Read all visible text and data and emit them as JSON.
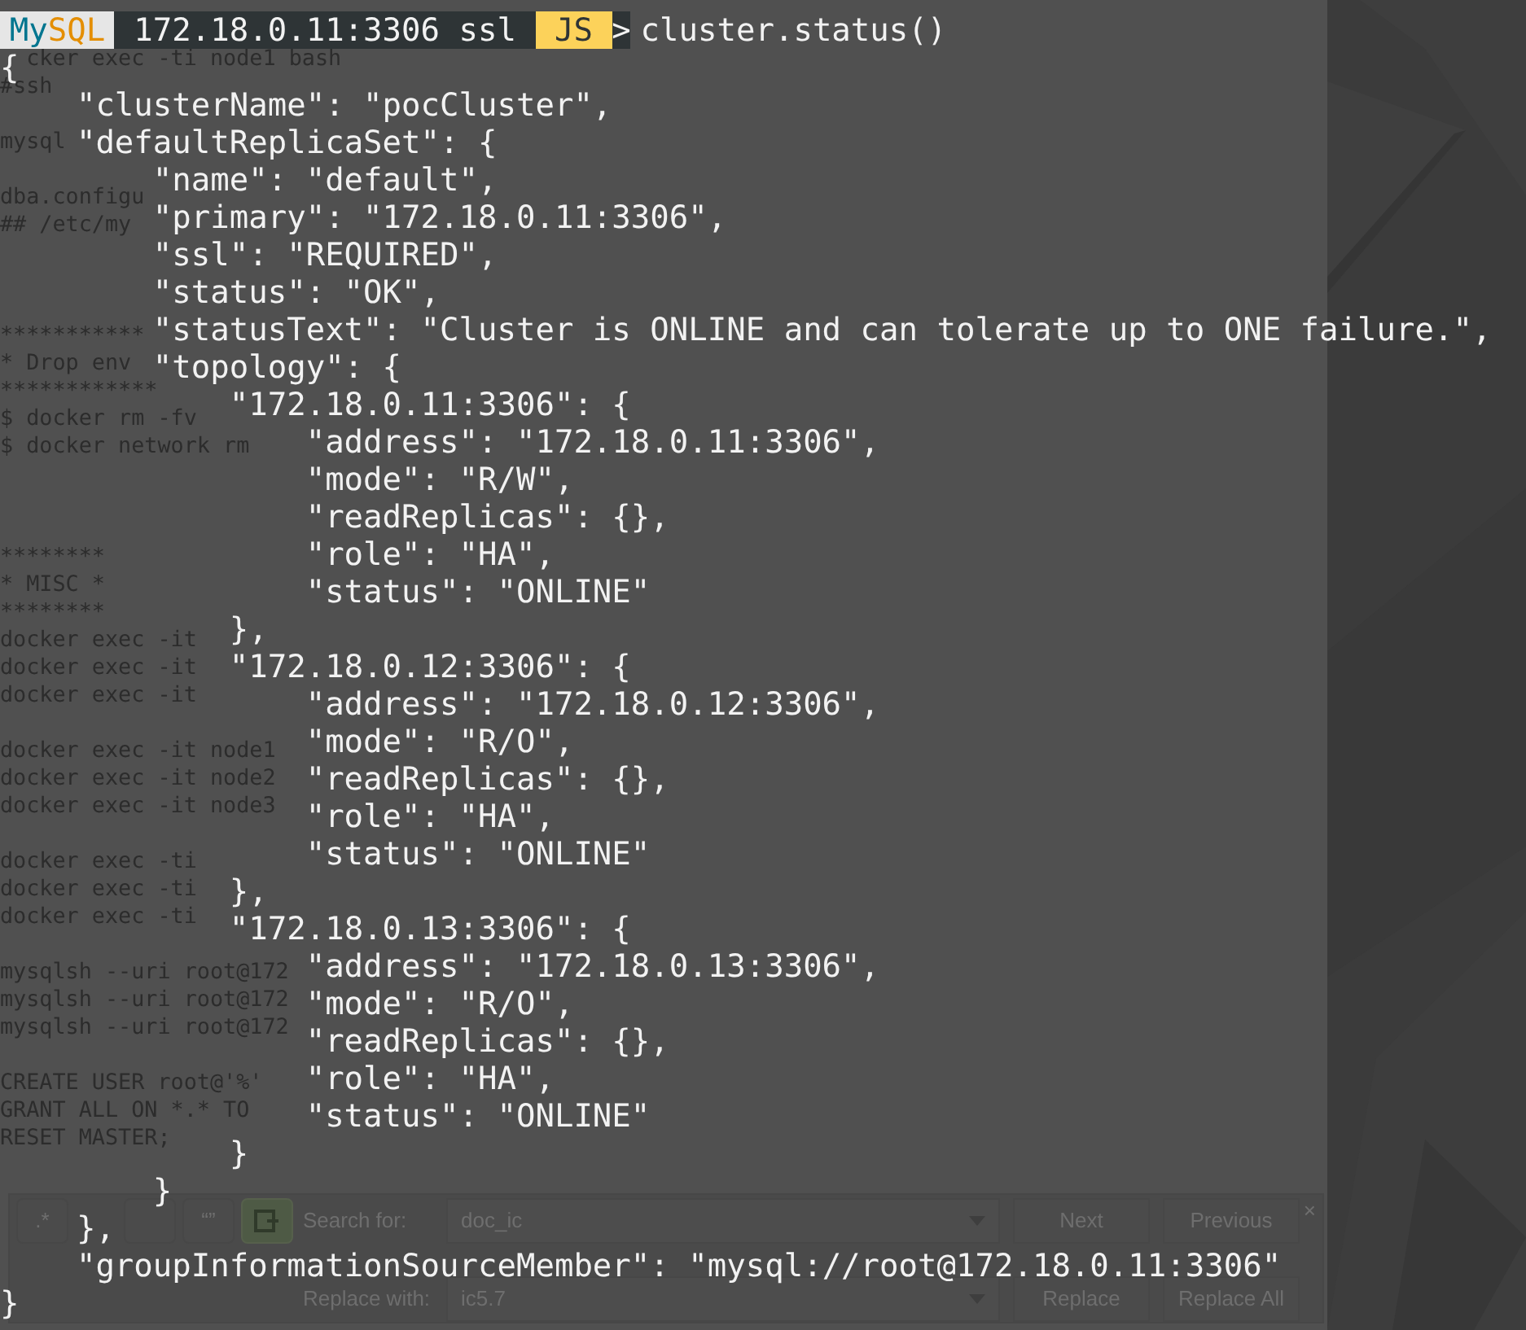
{
  "editor": {
    "lines": [
      {
        "kind": "offset",
        "text": "cker exec -ti node1 bash"
      },
      {
        "kind": "text",
        "text": "#ssh"
      },
      {
        "kind": "blank"
      },
      {
        "kind": "text",
        "text": "mysql"
      },
      {
        "kind": "blank"
      },
      {
        "kind": "text",
        "text": "dba.configu"
      },
      {
        "kind": "text",
        "text": "## /etc/my"
      },
      {
        "kind": "blank"
      },
      {
        "kind": "blank"
      },
      {
        "kind": "blank"
      },
      {
        "kind": "text",
        "text": "***********"
      },
      {
        "kind": "text",
        "text": "* Drop env"
      },
      {
        "kind": "text",
        "text": "************"
      },
      {
        "kind": "text",
        "text": "$ docker rm -fv"
      },
      {
        "kind": "text",
        "text": "$ docker network rm"
      },
      {
        "kind": "blank"
      },
      {
        "kind": "blank"
      },
      {
        "kind": "blank"
      },
      {
        "kind": "text",
        "text": "********"
      },
      {
        "kind": "text",
        "text": "* MISC *"
      },
      {
        "kind": "text",
        "text": "********"
      },
      {
        "kind": "text",
        "text": "docker exec -it"
      },
      {
        "kind": "text",
        "text": "docker exec -it"
      },
      {
        "kind": "text",
        "text": "docker exec -it"
      },
      {
        "kind": "blank"
      },
      {
        "kind": "text",
        "text": "docker exec -it node1"
      },
      {
        "kind": "text",
        "text": "docker exec -it node2"
      },
      {
        "kind": "text",
        "text": "docker exec -it node3"
      },
      {
        "kind": "blank"
      },
      {
        "kind": "text",
        "text": "docker exec -ti"
      },
      {
        "kind": "text",
        "text": "docker exec -ti"
      },
      {
        "kind": "text",
        "text": "docker exec -ti"
      },
      {
        "kind": "blank"
      },
      {
        "kind": "text",
        "text": "mysqlsh --uri root@172"
      },
      {
        "kind": "text",
        "text": "mysqlsh --uri root@172"
      },
      {
        "kind": "text",
        "text": "mysqlsh --uri root@172"
      },
      {
        "kind": "blank"
      },
      {
        "kind": "text",
        "text": "CREATE USER root@'%'"
      },
      {
        "kind": "text",
        "text": "GRANT ALL ON *.* TO"
      },
      {
        "kind": "text",
        "text": "RESET MASTER;"
      }
    ],
    "find_bar": {
      "toggles": [
        {
          "kind": "text",
          "label": ".*",
          "checked": false
        },
        {
          "kind": "covered",
          "checked": false
        },
        {
          "kind": "text",
          "label": "“”",
          "checked": false
        },
        {
          "kind": "icon",
          "checked": true
        }
      ],
      "search_label": "Search for:",
      "search_value": "doc_ic",
      "replace_label": "Replace with:",
      "replace_value": "ic5.7",
      "buttons": [
        "Next",
        "Previous"
      ],
      "replace_buttons": [
        "Replace",
        "Replace All"
      ],
      "close": "×"
    }
  },
  "terminal": {
    "prompt": {
      "product": [
        {
          "text": "My",
          "color": "#00758f"
        },
        {
          "text": "SQL",
          "color": "#e48e00"
        }
      ],
      "connection": "172.18.0.11:3306 ssl",
      "mode": "JS",
      "symbol": ">",
      "command": "cluster.status()"
    },
    "output": [
      {
        "text": "{",
        "children": [
          {
            "text": "\"clusterName\": \"pocCluster\","
          },
          {
            "text": "\"defaultReplicaSet\": {",
            "children": [
              {
                "text": "\"name\": \"default\","
              },
              {
                "text": "\"primary\": \"172.18.0.11:3306\","
              },
              {
                "text": "\"ssl\": \"REQUIRED\","
              },
              {
                "text": "\"status\": \"OK\","
              },
              {
                "text": "\"statusText\": \"Cluster is ONLINE and can tolerate up to ONE failure.\","
              },
              {
                "text": "\"topology\": {",
                "children": [
                  {
                    "text": "\"172.18.0.11:3306\": {",
                    "children": [
                      {
                        "text": "\"address\": \"172.18.0.11:3306\","
                      },
                      {
                        "text": "\"mode\": \"R/W\","
                      },
                      {
                        "text": "\"readReplicas\": {},"
                      },
                      {
                        "text": "\"role\": \"HA\","
                      },
                      {
                        "text": "\"status\": \"ONLINE\""
                      }
                    ]
                  },
                  {
                    "text": "},"
                  },
                  {
                    "text": "\"172.18.0.12:3306\": {",
                    "children": [
                      {
                        "text": "\"address\": \"172.18.0.12:3306\","
                      },
                      {
                        "text": "\"mode\": \"R/O\","
                      },
                      {
                        "text": "\"readReplicas\": {},"
                      },
                      {
                        "text": "\"role\": \"HA\","
                      },
                      {
                        "text": "\"status\": \"ONLINE\""
                      }
                    ]
                  },
                  {
                    "text": "},"
                  },
                  {
                    "text": "\"172.18.0.13:3306\": {",
                    "children": [
                      {
                        "text": "\"address\": \"172.18.0.13:3306\","
                      },
                      {
                        "text": "\"mode\": \"R/O\","
                      },
                      {
                        "text": "\"readReplicas\": {},"
                      },
                      {
                        "text": "\"role\": \"HA\","
                      },
                      {
                        "text": "\"status\": \"ONLINE\""
                      }
                    ]
                  },
                  {
                    "text": "}"
                  }
                ]
              },
              {
                "text": "}"
              }
            ]
          },
          {
            "text": "},"
          },
          {
            "text": "\"groupInformationSourceMember\": \"mysql://root@172.18.0.11:3306\""
          }
        ]
      },
      {
        "text": "}"
      }
    ]
  }
}
